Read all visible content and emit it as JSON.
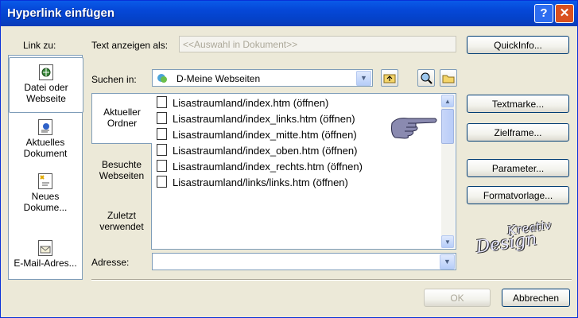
{
  "window": {
    "title": "Hyperlink einfügen",
    "help_glyph": "?",
    "close_glyph": "✕"
  },
  "link_to": {
    "label": "Link zu:",
    "items": [
      {
        "line1": "Datei oder",
        "line2": "Webseite"
      },
      {
        "line1": "Aktuelles",
        "line2": "Dokument"
      },
      {
        "line1": "Neues",
        "line2": "Dokume..."
      },
      {
        "line1": "E-Mail-Adres...",
        "line2": ""
      }
    ]
  },
  "text_display": {
    "label": "Text anzeigen als:",
    "value": "<<Auswahl in Dokument>>"
  },
  "search_in": {
    "label": "Suchen in:",
    "value": "D-Meine Webseiten"
  },
  "tabs": [
    {
      "line1": "Aktueller",
      "line2": "Ordner"
    },
    {
      "line1": "Besuchte",
      "line2": "Webseiten"
    },
    {
      "line1": "Zuletzt",
      "line2": "verwendet"
    }
  ],
  "files": [
    "Lisastraumland/index.htm (öffnen)",
    "Lisastraumland/index_links.htm (öffnen)",
    "Lisastraumland/index_mitte.htm (öffnen)",
    "Lisastraumland/index_oben.htm (öffnen)",
    "Lisastraumland/index_rechts.htm (öffnen)",
    "Lisastraumland/links/links.htm (öffnen)"
  ],
  "address": {
    "label": "Adresse:",
    "value": ""
  },
  "buttons": {
    "quickinfo": "QuickInfo...",
    "textmarke": "Textmarke...",
    "zielframe": "Zielframe...",
    "parameter": "Parameter...",
    "formatvorlage": "Formatvorlage...",
    "ok": "OK",
    "abbrechen": "Abbrechen"
  },
  "watermark": {
    "line1": "Kreativ",
    "line2": "Design"
  },
  "colors": {
    "title_bar": "#0548d8",
    "dialog_bg": "#ece9d8",
    "close_button": "#d9501f"
  }
}
